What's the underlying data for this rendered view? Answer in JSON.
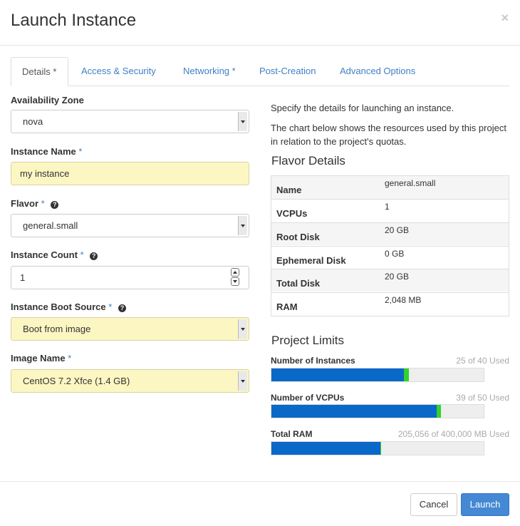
{
  "modal": {
    "title": "Launch Instance",
    "close_glyph": "×"
  },
  "tabs": [
    {
      "label": "Details",
      "star": "*"
    },
    {
      "label": "Access & Security",
      "star": ""
    },
    {
      "label": "Networking",
      "star": "*"
    },
    {
      "label": "Post-Creation",
      "star": ""
    },
    {
      "label": "Advanced Options",
      "star": ""
    }
  ],
  "form": {
    "availability_zone": {
      "label": "Availability Zone",
      "value": "nova"
    },
    "instance_name": {
      "label": "Instance Name",
      "required": "*",
      "value": "my instance"
    },
    "flavor": {
      "label": "Flavor",
      "required": "*",
      "help_glyph": "?",
      "value": "general.small"
    },
    "instance_count": {
      "label": "Instance Count",
      "required": "*",
      "help_glyph": "?",
      "value": "1"
    },
    "boot_source": {
      "label": "Instance Boot Source",
      "required": "*",
      "help_glyph": "?",
      "value": "Boot from image"
    },
    "image_name": {
      "label": "Image Name",
      "required": "*",
      "value": "CentOS 7.2 Xfce (1.4 GB)"
    }
  },
  "info": {
    "line1": "Specify the details for launching an instance.",
    "line2": "The chart below shows the resources used by this project in relation to the project's quotas."
  },
  "flavor_details": {
    "title": "Flavor Details",
    "rows": [
      {
        "key": "Name",
        "value": "general.small"
      },
      {
        "key": "VCPUs",
        "value": "1"
      },
      {
        "key": "Root Disk",
        "value": "20 GB"
      },
      {
        "key": "Ephemeral Disk",
        "value": "0 GB"
      },
      {
        "key": "Total Disk",
        "value": "20 GB"
      },
      {
        "key": "RAM",
        "value": "2,048 MB"
      }
    ]
  },
  "project_limits": {
    "title": "Project Limits",
    "items": [
      {
        "label": "Number of Instances",
        "used_text": "25 of 40 Used",
        "used_fraction": 0.625,
        "new_fraction": 0.025
      },
      {
        "label": "Number of VCPUs",
        "used_text": "39 of 50 Used",
        "used_fraction": 0.78,
        "new_fraction": 0.02
      },
      {
        "label": "Total RAM",
        "used_text": "205,056 of 400,000 MB Used",
        "used_fraction": 0.5126,
        "new_fraction": 0.005
      }
    ],
    "colors": {
      "used": "#0a68c9",
      "new": "#31d22b",
      "track": "#eeeeee"
    }
  },
  "footer": {
    "cancel_label": "Cancel",
    "launch_label": "Launch"
  },
  "colors": {
    "accent": "#3f80c5",
    "primary_button": "#4589d4",
    "highlight_field": "#fcf6c2"
  }
}
